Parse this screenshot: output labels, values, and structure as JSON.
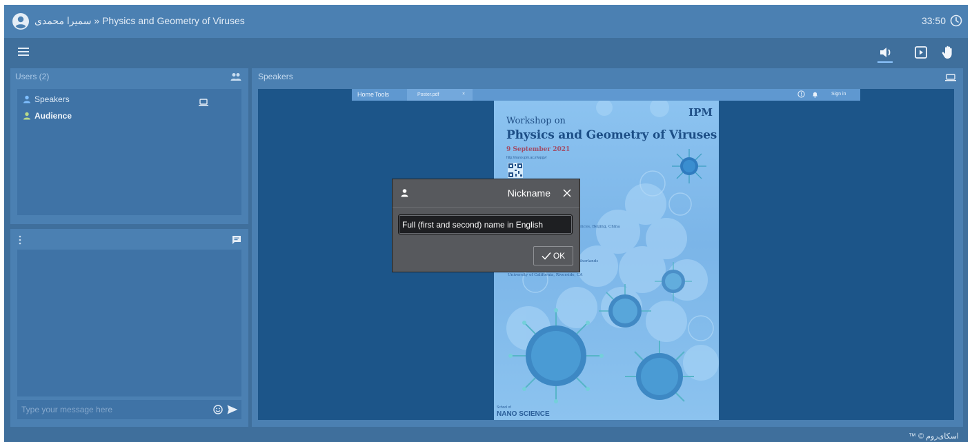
{
  "titlebar": {
    "user_name": "سمیرا محمدی",
    "separator": "»",
    "room_title": "Physics and Geometry of Viruses",
    "timer": "33:50"
  },
  "toolbar": {
    "menu_icon": "hamburger-menu-icon",
    "sound_icon": "volume-icon",
    "play_icon": "play-square-icon",
    "hand_icon": "raise-hand-icon"
  },
  "users_panel": {
    "title": "Users (2)",
    "items": [
      {
        "label": "Speakers"
      },
      {
        "label": "Audience"
      }
    ]
  },
  "chat_panel": {
    "placeholder": "Type your message here"
  },
  "stage": {
    "title": "Speakers",
    "browser": {
      "home": "Home",
      "tools": "Tools",
      "tab_name": "Poster.pdf",
      "tab_close": "×",
      "sign_in": "Sign in"
    },
    "poster": {
      "logo": "IPM",
      "workshop": "Workshop on",
      "title": "Physics and Geometry of Viruses",
      "date": "9 September 2021",
      "url": "http://nano.ipm.ac.ir/wpgv/",
      "affiliations": [
        "Sciences, Beijing, China",
        "gy, The Netherlands",
        "University of California, Riverside, CA"
      ],
      "school": "School of",
      "nano_science": "NANO SCIENCE"
    }
  },
  "modal": {
    "title": "Nickname",
    "input_value": "Full (first and second) name in English",
    "ok_label": "OK"
  },
  "footer": {
    "brand": "اسکای‌روم © ™"
  },
  "colors": {
    "app_bg": "#3f6f9c",
    "header_bg": "#4b80b2",
    "panel_inner": "#3f73a6",
    "stage_bg": "#1c5589",
    "accent": "#8ec5ff",
    "modal_bg": "#57595d"
  }
}
